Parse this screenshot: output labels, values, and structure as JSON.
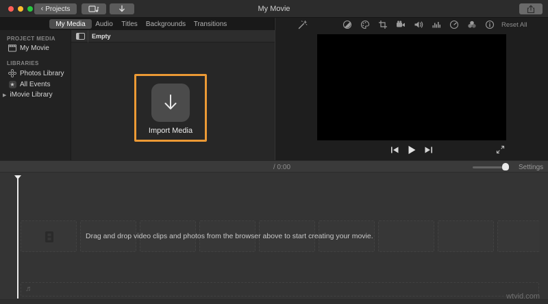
{
  "titlebar": {
    "title": "My Movie",
    "projects_label": "Projects",
    "back_chevron": "‹"
  },
  "tabs": {
    "selected": "My Media",
    "items": [
      {
        "label": "My Media"
      },
      {
        "label": "Audio"
      },
      {
        "label": "Titles"
      },
      {
        "label": "Backgrounds"
      },
      {
        "label": "Transitions"
      }
    ]
  },
  "sidebar": {
    "sections": [
      {
        "header": "PROJECT MEDIA",
        "items": [
          {
            "label": "My Movie",
            "icon": "clapboard-icon"
          }
        ]
      },
      {
        "header": "LIBRARIES",
        "items": [
          {
            "label": "Photos Library",
            "icon": "photos-flower-icon"
          },
          {
            "label": "All Events",
            "icon": "star-badge-icon"
          },
          {
            "label": "iMovie Library",
            "icon": "disclosure-triangle-icon"
          }
        ]
      }
    ],
    "star_glyph": "★",
    "disclosure_glyph": "▶"
  },
  "browser": {
    "header_label": "Empty",
    "import_button_label": "Import Media"
  },
  "viewer": {
    "reset_all_label": "Reset All",
    "adjust_icons": [
      "enhance-wand",
      "color-balance",
      "color-correction-palette",
      "crop",
      "stabilization-camera",
      "volume-speaker",
      "noise-reduction-eq",
      "speed-gauge",
      "effects-clouds",
      "info"
    ]
  },
  "transport_bar": {
    "time_display": "/ 0:00",
    "settings_label": "Settings"
  },
  "timeline": {
    "placeholder_text": "Drag and drop video clips and photos from the browser above to start creating your movie.",
    "clip_placeholder_count": 9,
    "music_note_glyph": "♬"
  },
  "watermark": "wtvid.com",
  "colors": {
    "accent_orange": "#EC9A35",
    "traffic_red": "#FF5F57",
    "traffic_yellow": "#FEBC2E",
    "traffic_green": "#28C840",
    "viewer_bg": "#1E1E1E",
    "timeline_bg": "#343434"
  }
}
